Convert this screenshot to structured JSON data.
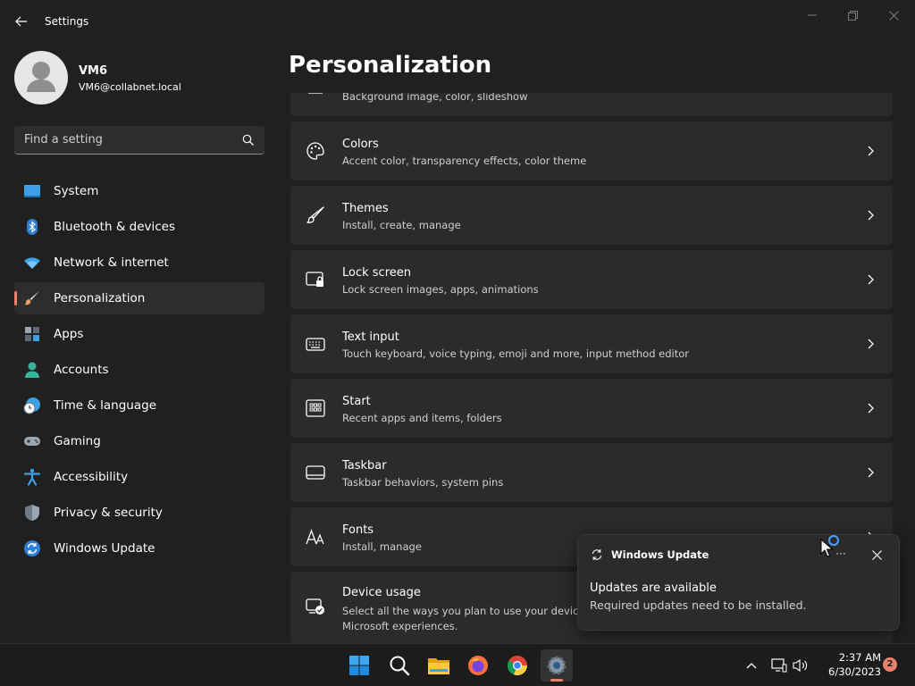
{
  "window": {
    "title": "Settings",
    "controls": [
      "minimize",
      "maximize",
      "close"
    ]
  },
  "profile": {
    "name": "VM6",
    "email": "VM6@collabnet.local"
  },
  "search": {
    "placeholder": "Find a setting"
  },
  "sidebar": {
    "items": [
      {
        "label": "System",
        "icon": "system-icon",
        "active": false
      },
      {
        "label": "Bluetooth & devices",
        "icon": "bluetooth-icon",
        "active": false
      },
      {
        "label": "Network & internet",
        "icon": "wifi-icon",
        "active": false
      },
      {
        "label": "Personalization",
        "icon": "brush-icon",
        "active": true
      },
      {
        "label": "Apps",
        "icon": "apps-icon",
        "active": false
      },
      {
        "label": "Accounts",
        "icon": "accounts-icon",
        "active": false
      },
      {
        "label": "Time & language",
        "icon": "clock-globe-icon",
        "active": false
      },
      {
        "label": "Gaming",
        "icon": "gamepad-icon",
        "active": false
      },
      {
        "label": "Accessibility",
        "icon": "accessibility-icon",
        "active": false
      },
      {
        "label": "Privacy & security",
        "icon": "shield-icon",
        "active": false
      },
      {
        "label": "Windows Update",
        "icon": "update-icon",
        "active": false
      }
    ]
  },
  "main": {
    "title": "Personalization",
    "cards": [
      {
        "title": "",
        "subtitle": "Background image, color, slideshow",
        "icon": "background-icon"
      },
      {
        "title": "Colors",
        "subtitle": "Accent color, transparency effects, color theme",
        "icon": "palette-icon"
      },
      {
        "title": "Themes",
        "subtitle": "Install, create, manage",
        "icon": "brush-icon"
      },
      {
        "title": "Lock screen",
        "subtitle": "Lock screen images, apps, animations",
        "icon": "lock-screen-icon"
      },
      {
        "title": "Text input",
        "subtitle": "Touch keyboard, voice typing, emoji and more, input method editor",
        "icon": "keyboard-icon"
      },
      {
        "title": "Start",
        "subtitle": "Recent apps and items, folders",
        "icon": "start-icon"
      },
      {
        "title": "Taskbar",
        "subtitle": "Taskbar behaviors, system pins",
        "icon": "taskbar-icon"
      },
      {
        "title": "Fonts",
        "subtitle": "Install, manage",
        "icon": "fonts-icon"
      },
      {
        "title": "Device usage",
        "subtitle": "Select all the ways you plan to use your device to",
        "subtitle2": "Microsoft experiences.",
        "icon": "device-usage-icon"
      }
    ]
  },
  "toast": {
    "app": "Windows Update",
    "more": "···",
    "title": "Updates are available",
    "body": "Required updates need to be installed."
  },
  "taskbar": {
    "apps": [
      "start-icon",
      "search-icon",
      "file-explorer-icon",
      "firefox-icon",
      "chrome-icon",
      "settings-icon"
    ],
    "active_app": "settings-icon",
    "tray": [
      "chevron-up-icon",
      "network-icon",
      "volume-icon"
    ],
    "time": "2:37 AM",
    "date": "6/30/2023",
    "notification_count": "2"
  },
  "colors": {
    "accent": "#e8816b",
    "background": "#202020",
    "card": "#2b2b2b"
  }
}
